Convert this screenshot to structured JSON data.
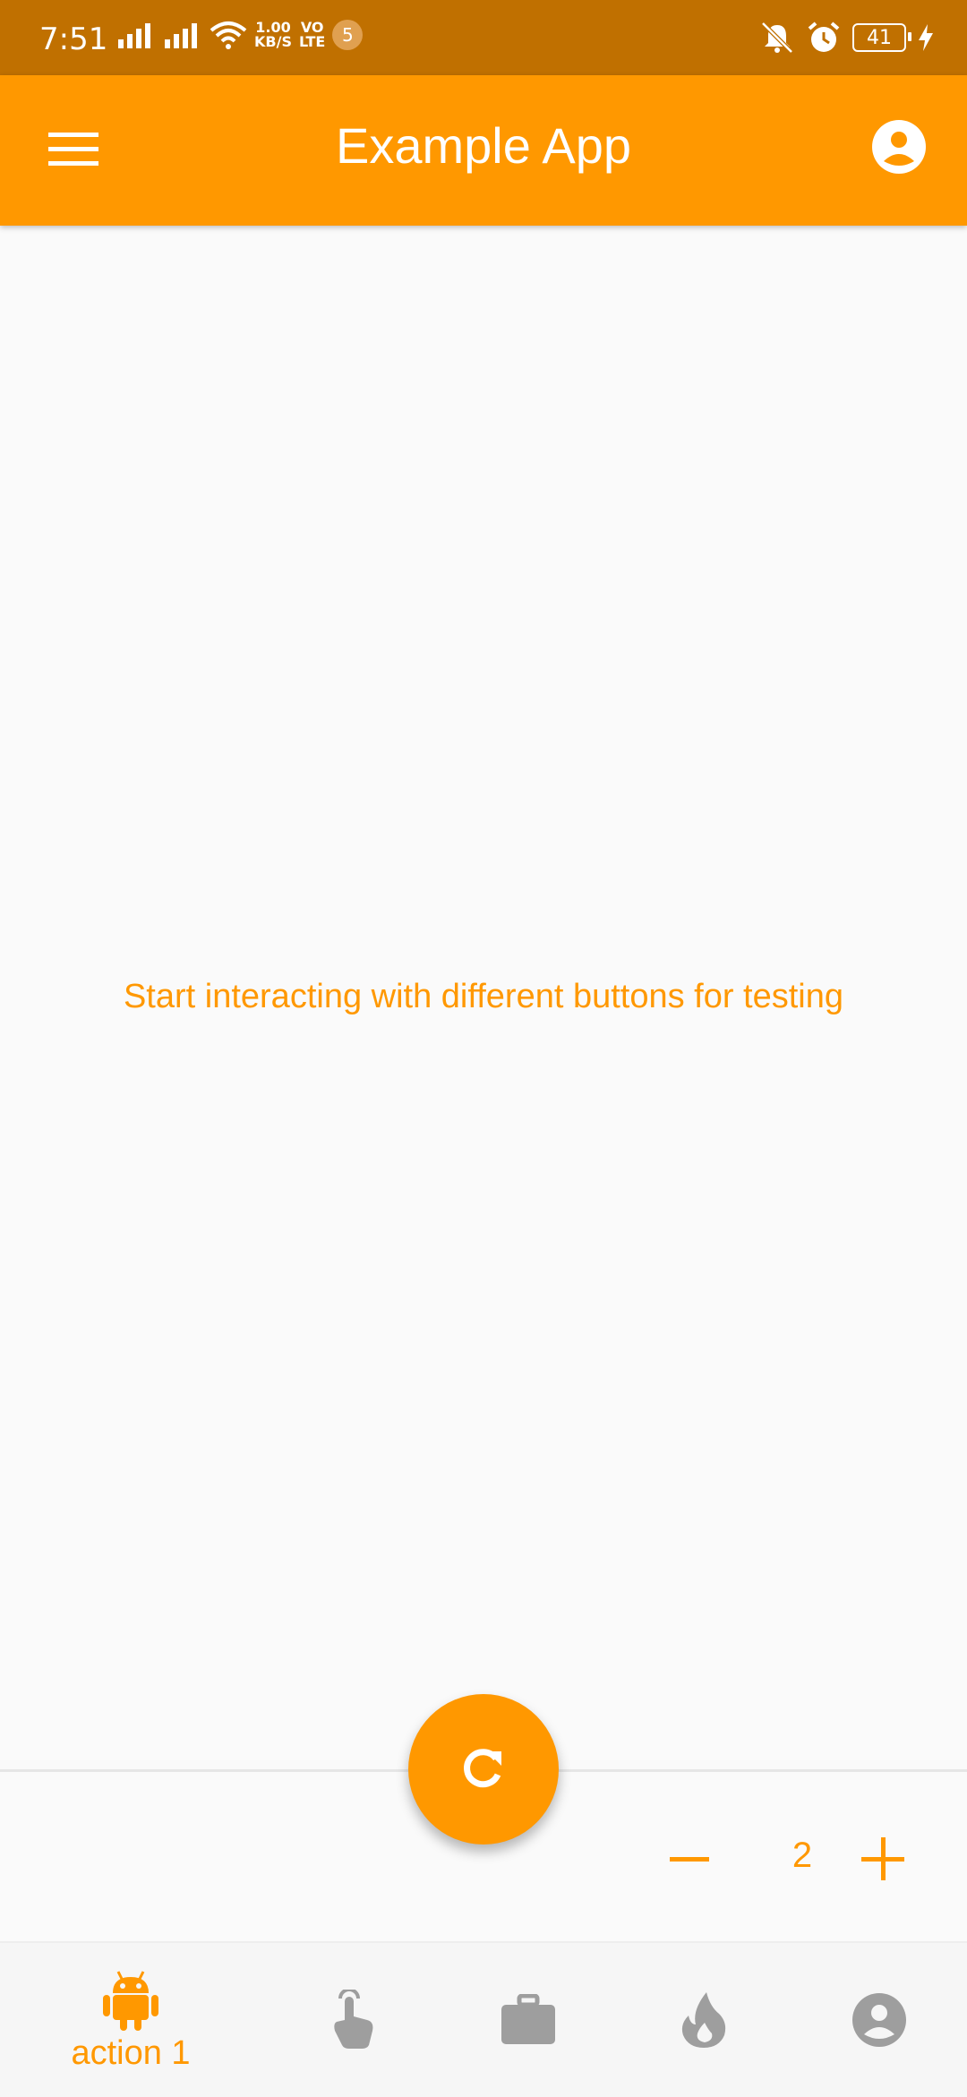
{
  "status_bar": {
    "time": "7:51",
    "net_speed_value": "1.00",
    "net_speed_unit": "KB/S",
    "volte_top": "VO",
    "volte_bottom": "LTE",
    "notification_count": "5",
    "battery": "41"
  },
  "app_bar": {
    "title": "Example App"
  },
  "main": {
    "message": "Start interacting with different buttons for testing"
  },
  "stepper": {
    "value": "2"
  },
  "bottom_nav": {
    "items": [
      {
        "label": "action 1",
        "icon": "android-icon",
        "selected": true
      },
      {
        "label": "",
        "icon": "touch-icon",
        "selected": false
      },
      {
        "label": "",
        "icon": "briefcase-icon",
        "selected": false
      },
      {
        "label": "",
        "icon": "fire-icon",
        "selected": false
      },
      {
        "label": "",
        "icon": "account-icon",
        "selected": false
      }
    ]
  },
  "colors": {
    "primary": "#ff9800",
    "status_bar": "#c07000",
    "inactive_icon": "#9e9e9e",
    "background": "#fafafa"
  }
}
